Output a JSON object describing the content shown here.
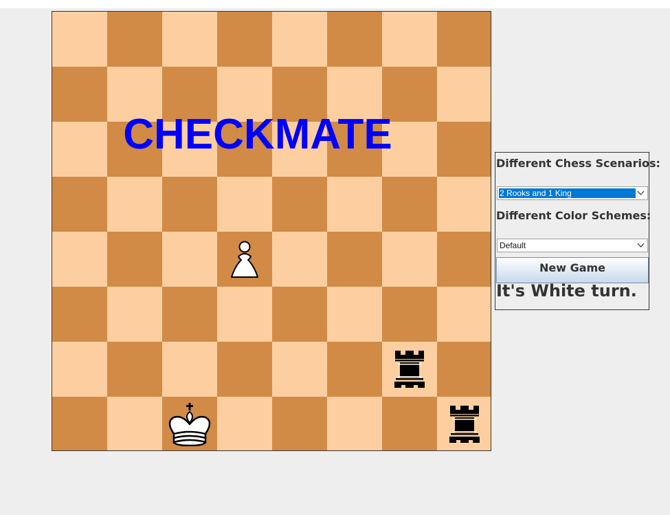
{
  "board": {
    "light_color": "#fdcfa0",
    "dark_color": "#d18b47",
    "banner": "CHECKMATE",
    "banner_color": "#0000ff",
    "pieces": [
      {
        "square": "d4",
        "piece": "white-pawn"
      },
      {
        "square": "g2",
        "piece": "black-rook"
      },
      {
        "square": "c1",
        "piece": "white-king"
      },
      {
        "square": "h1",
        "piece": "black-rook"
      }
    ]
  },
  "panel": {
    "scenarios_label": "Different Chess Scenarios:",
    "scenario_selected": "2 Rooks and 1 King",
    "schemes_label": "Different Color Schemes:",
    "scheme_selected": "Default",
    "new_game_label": "New Game",
    "status_text": "It's White turn."
  },
  "icons": [
    "chevron-down-icon",
    "white-pawn-icon",
    "black-rook-icon",
    "white-king-icon"
  ],
  "colors": {
    "accent_selection": "#0078d7",
    "window_background": "#eeeeee"
  }
}
